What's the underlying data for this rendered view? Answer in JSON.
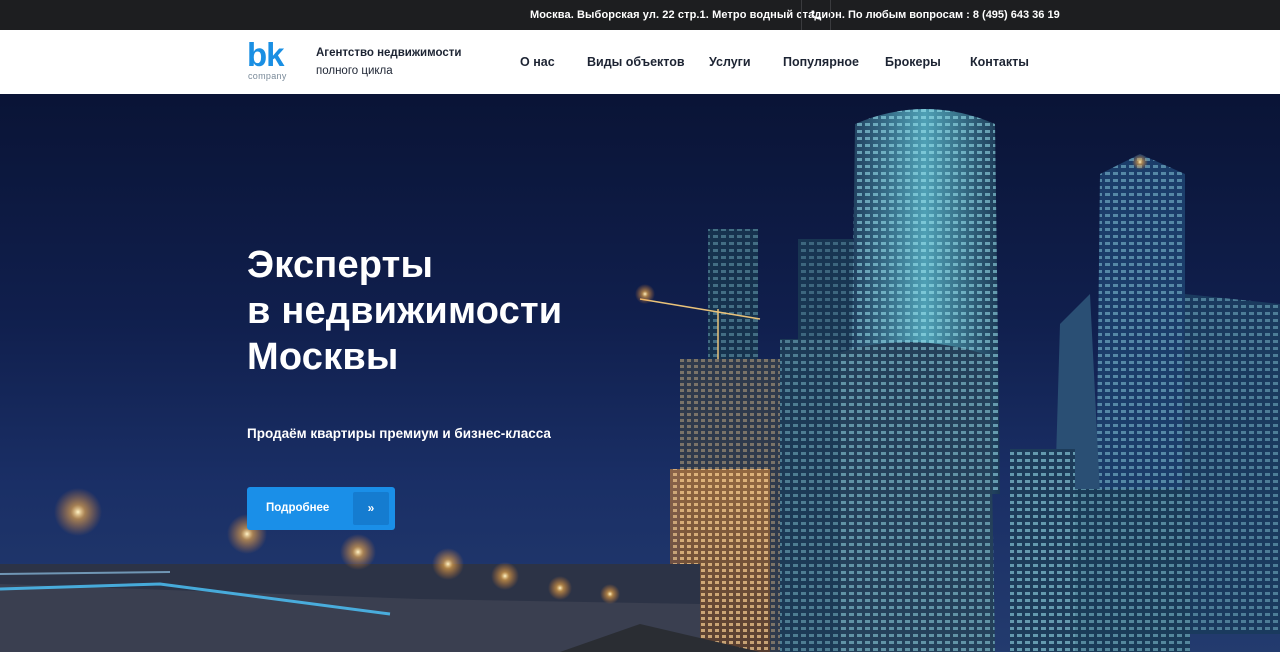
{
  "topbar": {
    "address": "Москва. Выборская ул. 22 стр.1. Метро водный стадион.",
    "phone_icon": "phone-icon",
    "phone_text": "По любым вопросам : 8 (495) 643 36 19"
  },
  "header": {
    "logo_mark": "bk",
    "logo_sub": "company",
    "tagline_line1": "Агентство недвижимости",
    "tagline_line2": "полного цикла",
    "nav": [
      {
        "label": "О нас"
      },
      {
        "label": "Виды объектов"
      },
      {
        "label": "Услуги"
      },
      {
        "label": "Популярное"
      },
      {
        "label": "Брокеры"
      },
      {
        "label": "Контакты"
      }
    ]
  },
  "hero": {
    "title_line1": "Эксперты",
    "title_line2": "в недвижимости",
    "title_line3": "Москвы",
    "subtitle": "Продаём квартиры премиум и бизнес-класса",
    "button_label": "Подробнее",
    "button_icon": "»"
  },
  "colors": {
    "accent": "#1a8fe8",
    "topbar_bg": "#1d1e20",
    "header_bg": "#ffffff",
    "text_dark": "#1d2433"
  }
}
